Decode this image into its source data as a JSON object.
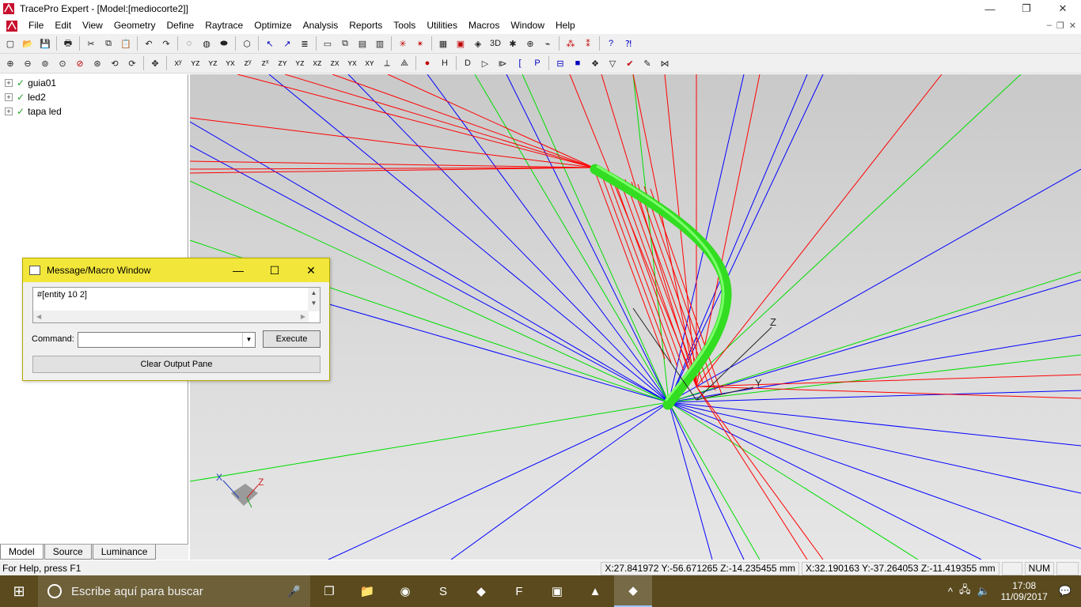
{
  "window": {
    "title": "TracePro Expert - [Model:[mediocorte2]]",
    "minimize_glyph": "—",
    "restore_glyph": "❐",
    "close_glyph": "✕"
  },
  "menu": {
    "items": [
      "File",
      "Edit",
      "View",
      "Geometry",
      "Define",
      "Raytrace",
      "Optimize",
      "Analysis",
      "Reports",
      "Tools",
      "Utilities",
      "Macros",
      "Window",
      "Help"
    ],
    "mdi_min": "–",
    "mdi_restore": "❐",
    "mdi_close": "✕"
  },
  "toolbar1": {
    "icons": [
      "new-icon",
      "open-icon",
      "save-icon",
      "print-icon",
      "cut-icon",
      "copy-icon",
      "paste-icon",
      "undo-icon",
      "redo-icon",
      "hide-icon",
      "show-icon",
      "show-all-icon",
      "render-icon",
      "select-icon",
      "select-object-icon",
      "properties-icon",
      "window-icon",
      "cascade-icon",
      "tile-h-icon",
      "tile-v-icon",
      "ray-source-icon",
      "rev-icon",
      "grid-icon",
      "preview-icon",
      "target-icon",
      "3d-icon",
      "irradiance-icon",
      "crosshair-icon",
      "plot-icon",
      "srt-icon",
      "dpl-icon",
      "help-icon",
      "context-help-icon"
    ],
    "glyphs": [
      "▢",
      "📂",
      "💾",
      "🖶",
      "✂",
      "⧉",
      "📋",
      "↶",
      "↷",
      "◌",
      "◍",
      "⬬",
      "⬡",
      "↖",
      "↗",
      "≣",
      "▭",
      "⧉",
      "▤",
      "▥",
      "✳",
      "✴",
      "▦",
      "▣",
      "◈",
      "3D",
      "✱",
      "⊕",
      "⌁",
      "⁂",
      "⁑",
      "?",
      "⁈"
    ]
  },
  "toolbar2": {
    "icons": [
      "zoom-in-icon",
      "zoom-out-icon",
      "zoom-window-icon",
      "zoom-all-icon",
      "zoom-prev-icon",
      "zoom-fit-icon",
      "rotate-icon",
      "rotate-x-icon",
      "pan-icon",
      "view-xy-icon",
      "view-yz-icon",
      "view-xz-icon",
      "view-yx-icon",
      "view-zy-icon",
      "view-zx-icon",
      "view-zy2-icon",
      "view-yz2-icon",
      "view-xz2-icon",
      "view-zx2-icon",
      "view-yx2-icon",
      "view-xy2-icon",
      "view-iso-icon",
      "view-iso2-icon",
      "trace-icon",
      "h-icon",
      "lens-icon",
      "arrow-icon",
      "surface-icon",
      "bracket-icon",
      "p-icon",
      "block-icon",
      "square-icon",
      "sphere-icon",
      "gem-icon",
      "check-icon",
      "ruler-icon",
      "axis-icon"
    ],
    "glyphs": [
      "⊕",
      "⊖",
      "⊚",
      "⊙",
      "⊘",
      "⊛",
      "⟲",
      "⟳",
      "✥",
      "xʸ",
      "ʏz",
      "ʏz",
      "ʏx",
      "zʸ",
      "zˣ",
      "zʏ",
      "ʏz",
      "xz",
      "zx",
      "ʏx",
      "xʏ",
      "⟂",
      "⟁",
      "●",
      "H",
      "D",
      "▷",
      "⧐",
      "[",
      "P",
      "⊟",
      "■",
      "❖",
      "▽",
      "✔",
      "✎",
      "⋈"
    ]
  },
  "tree": {
    "items": [
      {
        "label": "guia01"
      },
      {
        "label": "led2"
      },
      {
        "label": "tapa led"
      }
    ],
    "tabs": [
      "Model",
      "Source",
      "Luminance"
    ]
  },
  "viewport": {
    "axis_labels": {
      "x": "X",
      "y": "Y",
      "z": "Z"
    },
    "colors": {
      "red_rays": "#ff0000",
      "blue_rays": "#0000ff",
      "green_rays": "#00dd00",
      "solid": "#33dd22"
    }
  },
  "message_window": {
    "title": "Message/Macro Window",
    "output_text": "#[entity 10 2]",
    "command_label": "Command:",
    "command_value": "",
    "execute_label": "Execute",
    "clear_label": "Clear Output Pane",
    "scroll_up": "▲",
    "scroll_down": "▼",
    "scroll_left": "◀",
    "scroll_right": "▶",
    "dropdown_glyph": "▼"
  },
  "statusbar": {
    "help": "For Help, press F1",
    "coord1": "X:27.841972 Y:-56.671265 Z:-14.235455 mm",
    "coord2": "X:32.190163 Y:-37.264053 Z:-11.419355 mm",
    "num": "NUM"
  },
  "taskbar": {
    "start_glyph": "⊞",
    "search_placeholder": "Escribe aquí para buscar",
    "mic_glyph": "🎤",
    "time": "17:08",
    "date": "11/09/2017",
    "apps": [
      "task-view-icon",
      "file-explorer-icon",
      "chrome-icon",
      "skype-icon",
      "tracepro-icon",
      "filezilla-icon",
      "network-app-icon",
      "matlab-icon",
      "tracepro-active-icon"
    ],
    "app_glyphs": [
      "❐",
      "📁",
      "◉",
      "S",
      "◆",
      "F",
      "▣",
      "▲",
      "◆"
    ],
    "tray_glyphs": [
      "^",
      "🖧",
      "🔈",
      "💬"
    ]
  }
}
